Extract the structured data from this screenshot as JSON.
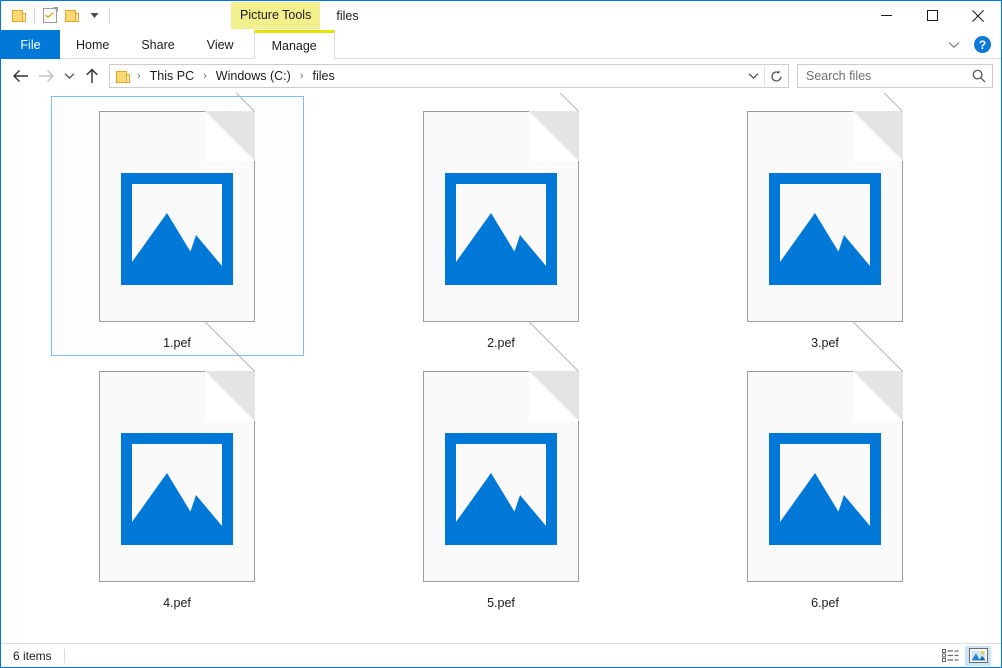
{
  "window": {
    "title": "files",
    "contextual_tools_label": "Picture Tools",
    "accent_color": "#0078d7",
    "contextual_tab_color": "#f2f08c",
    "selection_border_color": "#7fc0ee",
    "picture_glyph_color": "#0078d7"
  },
  "quick_access": {
    "items": [
      {
        "name": "new-folder-icon",
        "tooltip": "New folder"
      },
      {
        "name": "properties-icon",
        "tooltip": "Properties"
      },
      {
        "name": "folder-icon",
        "tooltip": "Folder"
      },
      {
        "name": "customize-dropdown-icon",
        "tooltip": "Customize Quick Access Toolbar"
      }
    ]
  },
  "window_controls": {
    "minimize": "minimize-icon",
    "maximize": "maximize-icon",
    "close": "close-icon"
  },
  "ribbon": {
    "tabs": [
      {
        "label": "File",
        "active": false,
        "is_file": true
      },
      {
        "label": "Home",
        "active": false,
        "is_file": false
      },
      {
        "label": "Share",
        "active": false,
        "is_file": false
      },
      {
        "label": "View",
        "active": false,
        "is_file": false
      }
    ],
    "contextual_tab": {
      "label": "Manage",
      "active": true
    },
    "collapse_label": "Minimize the Ribbon",
    "help_label": "?"
  },
  "navigation": {
    "back": "back-arrow-icon",
    "forward": "forward-arrow-icon",
    "recent": "recent-locations-icon",
    "up": "up-arrow-icon",
    "breadcrumbs": [
      "This PC",
      "Windows (C:)",
      "files"
    ],
    "separator": "›",
    "dropdown": "address-dropdown-icon",
    "refresh": "refresh-icon"
  },
  "search": {
    "placeholder": "Search files",
    "value": "",
    "icon": "search-icon"
  },
  "files": [
    {
      "name": "1.pef",
      "type": "pef",
      "selected": true
    },
    {
      "name": "2.pef",
      "type": "pef",
      "selected": false
    },
    {
      "name": "3.pef",
      "type": "pef",
      "selected": false
    },
    {
      "name": "4.pef",
      "type": "pef",
      "selected": false
    },
    {
      "name": "5.pef",
      "type": "pef",
      "selected": false
    },
    {
      "name": "6.pef",
      "type": "pef",
      "selected": false
    }
  ],
  "status": {
    "item_count": "6 items",
    "views": [
      {
        "name": "details-view",
        "active": false
      },
      {
        "name": "large-icons-view",
        "active": true
      }
    ]
  }
}
